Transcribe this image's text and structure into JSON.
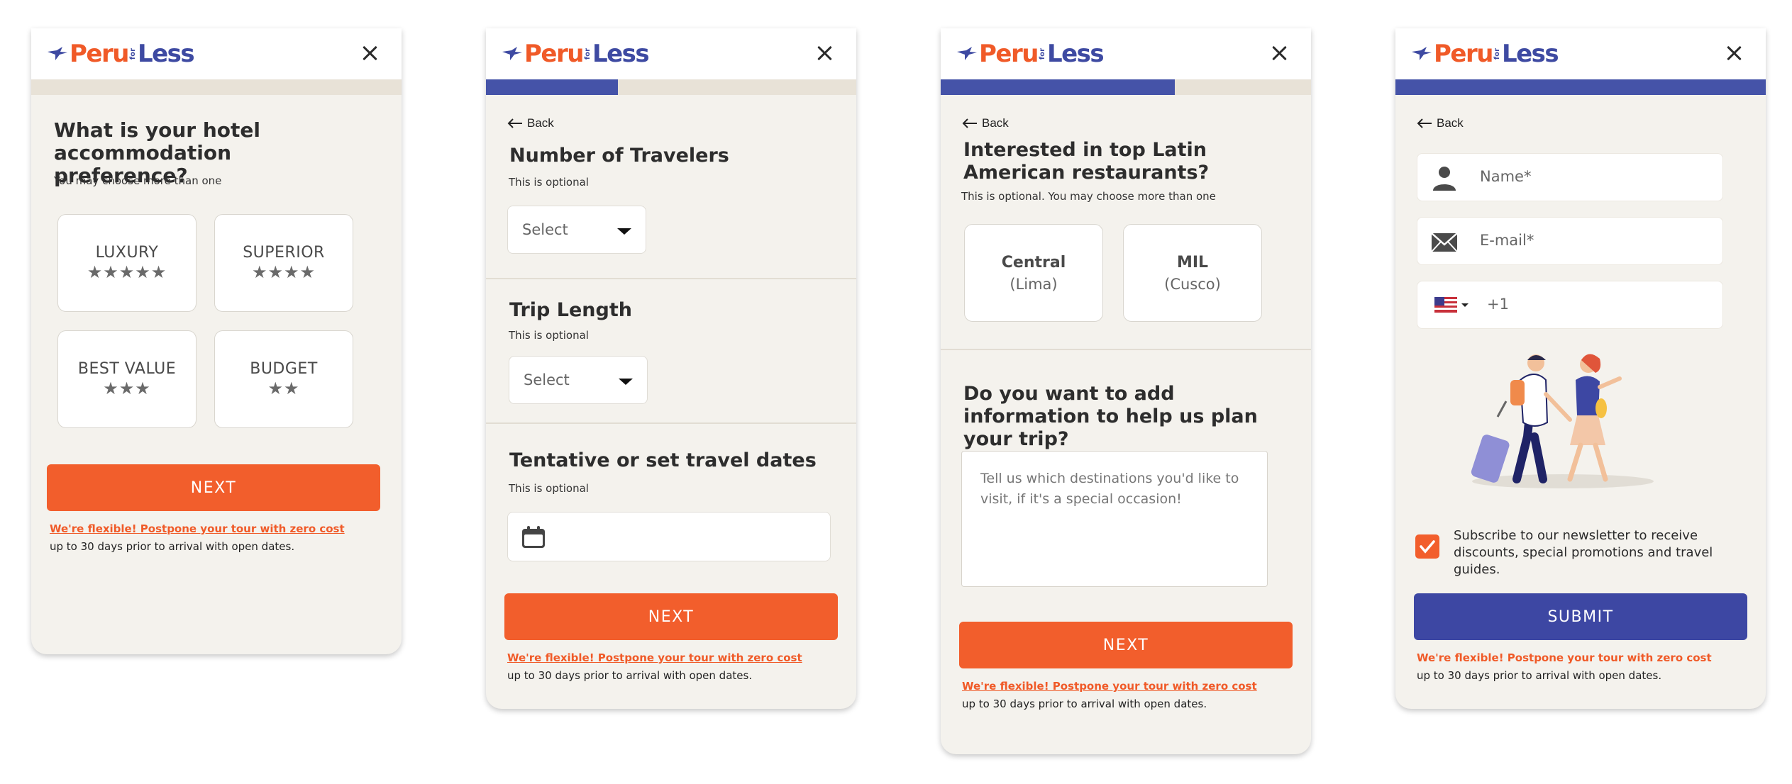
{
  "brand": {
    "part1": "Peru",
    "for": "for",
    "part2": "Less"
  },
  "colors": {
    "orange": "#f25e2c",
    "blue": "#3d47a3",
    "panel_bg": "#f4f2ed",
    "progress_track": "#e8e2d7"
  },
  "common": {
    "back_label": "Back",
    "next_label": "NEXT",
    "flexible_link": "We're flexible! Postpone your tour with zero cost",
    "flexible_note": "up to 30 days prior to arrival with open dates."
  },
  "step1": {
    "progress": 0,
    "question": "What is your hotel accommodation preference?",
    "subtitle": "You may choose more than one",
    "options": [
      {
        "label": "LUXURY",
        "stars": "★★★★★"
      },
      {
        "label": "SUPERIOR",
        "stars": "★★★★"
      },
      {
        "label": "BEST VALUE",
        "stars": "★★★"
      },
      {
        "label": "BUDGET",
        "stars": "★★"
      }
    ]
  },
  "step2": {
    "progress": 0.36,
    "travelers": {
      "title": "Number of Travelers",
      "note": "This is optional",
      "value": "Select"
    },
    "trip_length": {
      "title": "Trip Length",
      "note": "This is optional",
      "value": "Select"
    },
    "dates": {
      "title": "Tentative or set travel dates",
      "note": "This is optional"
    }
  },
  "step3": {
    "progress": 0.63,
    "question": "Interested in top Latin American restaurants?",
    "subtitle": "This is optional. You may choose more than one",
    "restaurants": [
      {
        "name": "Central",
        "city": "(Lima)"
      },
      {
        "name": "MIL",
        "city": "(Cusco)"
      }
    ],
    "info_question": "Do you want to add information to help us plan your trip?",
    "info_placeholder": "Tell us which destinations you'd like to visit, if it's a special occasion!"
  },
  "step4": {
    "progress": 1,
    "name_placeholder": "Name*",
    "email_placeholder": "E-mail*",
    "phone_code": "+1",
    "newsletter_label": "Subscribe to our newsletter to receive discounts, special promotions and travel guides.",
    "newsletter_checked": true,
    "submit_label": "SUBMIT"
  }
}
